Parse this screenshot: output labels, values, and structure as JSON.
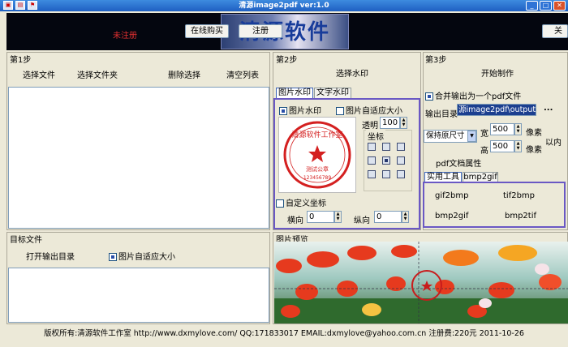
{
  "window": {
    "title": "清源image2pdf ver:1.0"
  },
  "banner": {
    "register_text": "未注册",
    "buy_label": "在线购买",
    "register_label": "注册",
    "logo_text": "清源软件",
    "about_label": "关于"
  },
  "step1": {
    "title": "第1步",
    "select_file": "选择文件",
    "select_folder": "选择文件夹",
    "delete_selected": "删除选择",
    "clear_list": "清空列表"
  },
  "step2": {
    "title": "第2步",
    "select_watermark": "选择水印",
    "tabs": [
      "图片水印",
      "文字水印"
    ],
    "image_watermark_label": "图片水印",
    "auto_fit_label": "图片自适应大小",
    "opacity_label": "透明",
    "opacity_value": "100",
    "coord_label": "坐标",
    "stamp_text": "清源软件工作室",
    "stamp_sub": "测试公章",
    "stamp_num": "123456789",
    "custom_coord_label": "自定义坐标",
    "horiz_label": "横向",
    "horiz_value": "0",
    "vert_label": "纵向",
    "vert_value": "0"
  },
  "step3": {
    "title": "第3步",
    "start_label": "开始制作",
    "merge_label": "合并输出为一个pdf文件",
    "output_dir_label": "输出目录",
    "output_dir_value": "源image2pdf\\output\\",
    "browse_label": "...",
    "size_option": "保持原尺寸",
    "width_label": "宽",
    "width_value": "500",
    "height_label": "高",
    "height_value": "500",
    "unit": "像素",
    "within": "以内",
    "pdf_props": "pdf文档属性",
    "tools_tabs": [
      "实用工具",
      "bmp2gif"
    ],
    "tools": [
      "gif2bmp",
      "tif2bmp",
      "bmp2gif",
      "bmp2tif"
    ]
  },
  "target": {
    "title": "目标文件",
    "open_output": "打开输出目录",
    "auto_fit_label": "图片自适应大小"
  },
  "preview": {
    "title": "图片预览"
  },
  "footer": {
    "text": "版权所有:清源软件工作室 http://www.dxmylove.com/ QQ:171833017 EMAIL:dxmylove@yahoo.com.cn 注册费:220元 2011-10-26"
  }
}
